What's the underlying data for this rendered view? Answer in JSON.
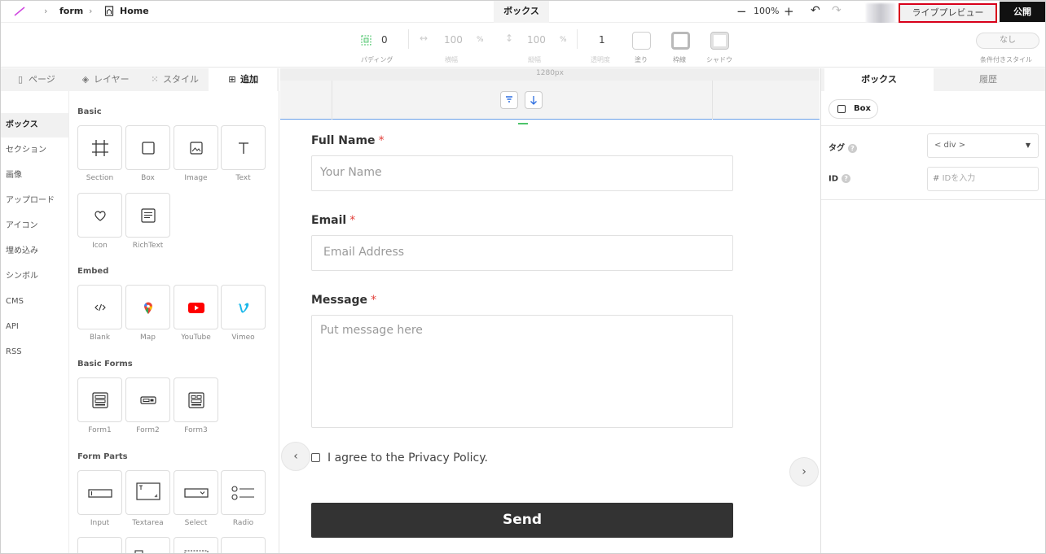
{
  "breadcrumb": {
    "project": "form",
    "page": "Home"
  },
  "header": {
    "center_tab": "ボックス",
    "zoom": "100%",
    "zoom_minus": "−",
    "zoom_plus": "+",
    "live_preview": "ライブプレビュー",
    "publish": "公開"
  },
  "toolbar": {
    "padding_value": "0",
    "padding_label": "パディング",
    "width_value": "100",
    "width_unit": "%",
    "width_label": "横幅",
    "height_value": "100",
    "height_unit": "%",
    "height_label": "縦幅",
    "opacity_value": "1",
    "opacity_label": "透明度",
    "fill_label": "塗り",
    "border_label": "枠線",
    "shadow_label": "シャドウ",
    "condition_value": "なし",
    "condition_label": "条件付きスタイル"
  },
  "left_tabs": [
    {
      "label": "ページ"
    },
    {
      "label": "レイヤー"
    },
    {
      "label": "スタイル"
    },
    {
      "label": "追加"
    }
  ],
  "categories": [
    "ボックス",
    "セクション",
    "画像",
    "アップロード",
    "アイコン",
    "埋め込み",
    "シンボル",
    "CMS",
    "API",
    "RSS"
  ],
  "sections": {
    "basic": "Basic",
    "embed": "Embed",
    "basic_forms": "Basic Forms",
    "form_parts": "Form Parts"
  },
  "components": {
    "basic": [
      "Section",
      "Box",
      "Image",
      "Text",
      "Icon",
      "RichText"
    ],
    "embed": [
      "Blank",
      "Map",
      "YouTube",
      "Vimeo"
    ],
    "basic_forms": [
      "Form1",
      "Form2",
      "Form3"
    ],
    "form_parts": [
      "Input",
      "Textarea",
      "Select",
      "Radio"
    ]
  },
  "canvas": {
    "ruler": "1280px",
    "fields": [
      {
        "label": "Full Name",
        "required": "*",
        "placeholder": "Your Name"
      },
      {
        "label": "Email",
        "required": "*",
        "placeholder": "Email Address"
      },
      {
        "label": "Message",
        "required": "*",
        "placeholder": "Put message here"
      }
    ],
    "agree": "I agree to the Privacy Policy.",
    "send": "Send"
  },
  "right_panel": {
    "tabs": [
      "ボックス",
      "履歴"
    ],
    "element_type": "Box",
    "tag_label": "タグ",
    "tag_value": "< div >",
    "id_label": "ID",
    "id_placeholder": "IDを入力"
  },
  "colors": {
    "accent_red": "#d8001a",
    "publish_bg": "#111111",
    "send_bg": "#333333",
    "selection_blue": "#6aa0e8",
    "required_red": "#e2403a"
  }
}
